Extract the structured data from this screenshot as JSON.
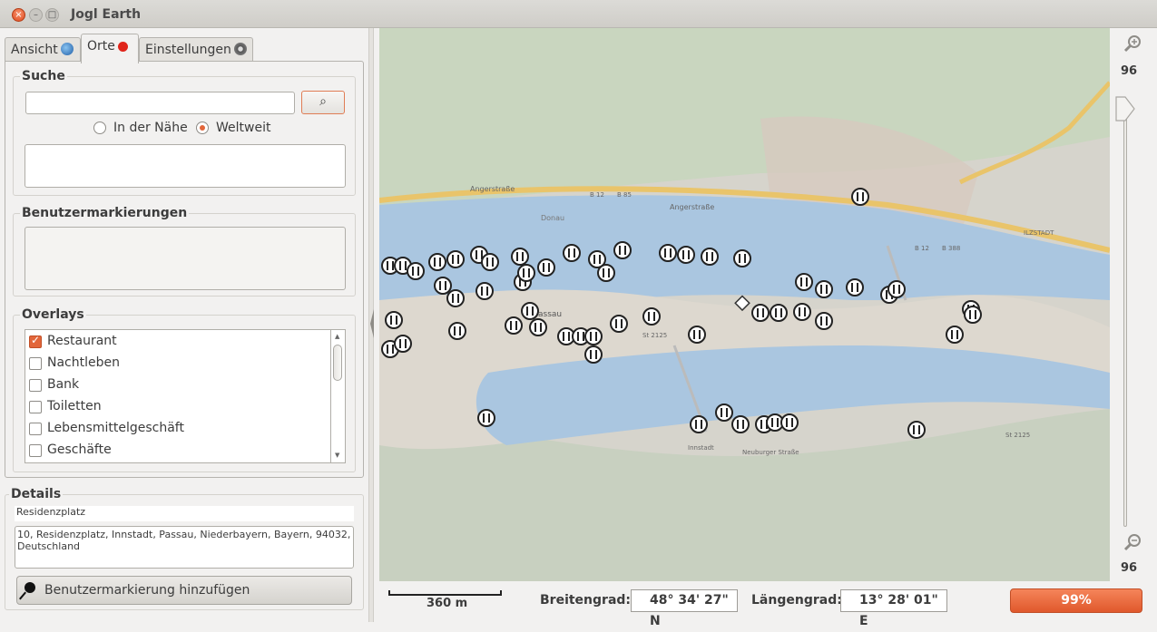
{
  "window": {
    "title": "Jogl Earth",
    "close_glyph": "×",
    "min_glyph": "–",
    "max_glyph": "□"
  },
  "tabs": [
    {
      "label": "Ansicht",
      "icon": "globe-icon"
    },
    {
      "label": "Orte",
      "icon": "pin-icon"
    },
    {
      "label": "Einstellungen",
      "icon": "gear-icon"
    }
  ],
  "search": {
    "title": "Suche",
    "value": "",
    "button_icon": "magnifier-icon",
    "button_glyph": "⌕",
    "radio_near": "In der Nähe",
    "radio_world": "Weltweit",
    "selected": "Weltweit"
  },
  "user_markers": {
    "title": "Benutzermarkierungen"
  },
  "overlays": {
    "title": "Overlays",
    "items": [
      {
        "label": "Restaurant",
        "checked": true
      },
      {
        "label": "Nachtleben",
        "checked": false
      },
      {
        "label": "Bank",
        "checked": false
      },
      {
        "label": "Toiletten",
        "checked": false
      },
      {
        "label": "Lebensmittelgeschäft",
        "checked": false
      },
      {
        "label": "Geschäfte",
        "checked": false
      }
    ]
  },
  "details": {
    "title": "Details",
    "name": "Residenzplatz",
    "address": "10, Residenzplatz, Innstadt, Passau, Niederbayern, Bayern, 94032, Deutschland",
    "add_button": "Benutzermarkierung hinzufügen"
  },
  "map": {
    "street_labels": [
      "Angerstraße",
      "Angerstraße",
      "B 12",
      "B 85",
      "B 12",
      "B 388",
      "Donau",
      "St 2125",
      "St 2125",
      "Neuburger Straße",
      "Innstadt",
      "Passau",
      "ILZSTADT"
    ],
    "restaurant_icon": "restaurant-icon",
    "accent": "#e2663a"
  },
  "zoom": {
    "level": "96",
    "min_label": "96",
    "zoom_in_icon": "zoom-in-icon",
    "zoom_out_icon": "zoom-out-icon"
  },
  "status": {
    "scale": "360 m",
    "lat_label": "Breitengrad:",
    "lat_value": "48° 34' 27\" N",
    "lon_label": "Längengrad:",
    "lon_value": "13° 28' 01\" E",
    "progress": "99%",
    "progress_fraction": 0.99
  }
}
